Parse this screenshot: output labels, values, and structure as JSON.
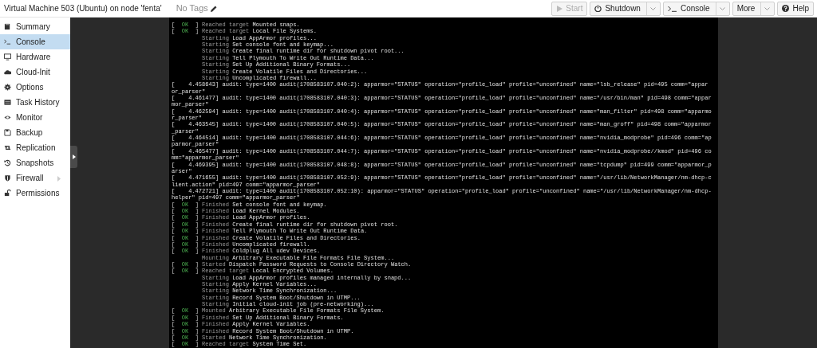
{
  "header": {
    "title": "Virtual Machine 503 (Ubuntu) on node 'fenta'",
    "tags": "No Tags",
    "buttons": [
      {
        "label": "Start",
        "kind": "start",
        "disabled": true,
        "split": false
      },
      {
        "label": "Shutdown",
        "kind": "power",
        "disabled": false,
        "split": true
      },
      {
        "label": "Console",
        "kind": "console",
        "disabled": false,
        "split": true
      },
      {
        "label": "More",
        "kind": "plain",
        "disabled": false,
        "split": true
      },
      {
        "label": "Help",
        "kind": "help",
        "disabled": false,
        "split": false
      }
    ]
  },
  "sidebar": {
    "items": [
      {
        "label": "Summary",
        "selected": false,
        "expandable": false
      },
      {
        "label": "Console",
        "selected": true,
        "expandable": false
      },
      {
        "label": "Hardware",
        "selected": false,
        "expandable": false
      },
      {
        "label": "Cloud-Init",
        "selected": false,
        "expandable": false
      },
      {
        "label": "Options",
        "selected": false,
        "expandable": false
      },
      {
        "label": "Task History",
        "selected": false,
        "expandable": false
      },
      {
        "label": "Monitor",
        "selected": false,
        "expandable": false
      },
      {
        "label": "Backup",
        "selected": false,
        "expandable": false
      },
      {
        "label": "Replication",
        "selected": false,
        "expandable": false
      },
      {
        "label": "Snapshots",
        "selected": false,
        "expandable": false
      },
      {
        "label": "Firewall",
        "selected": false,
        "expandable": true
      },
      {
        "label": "Permissions",
        "selected": false,
        "expandable": false
      }
    ]
  },
  "console": {
    "lines": [
      {
        "kind": "ok",
        "open": "[",
        "status": "OK",
        "close": "]",
        "verb": "Reached target",
        "text": "Mounted snaps."
      },
      {
        "kind": "ok",
        "open": "[",
        "status": "OK",
        "close": "]",
        "verb": "Reached target",
        "text": "Local File Systems."
      },
      {
        "kind": "plain",
        "verb": "Starting",
        "text": "Load AppArmor profiles..."
      },
      {
        "kind": "plain",
        "verb": "Starting",
        "text": "Set console font and keymap..."
      },
      {
        "kind": "plain",
        "verb": "Starting",
        "text": "Create final runtime dir for shutdown pivot root..."
      },
      {
        "kind": "plain",
        "verb": "Starting",
        "text": "Tell Plymouth To Write Out Runtime Data..."
      },
      {
        "kind": "plain",
        "verb": "Starting",
        "text": "Set Up Additional Binary Formats..."
      },
      {
        "kind": "plain",
        "verb": "Starting",
        "text": "Create Volatile Files and Directories..."
      },
      {
        "kind": "plain",
        "verb": "Starting",
        "text": "Uncomplicated firewall..."
      },
      {
        "kind": "raw",
        "text": "[    4.458643] audit: type=1400 audit(1708583107.040:2): apparmor=\"STATUS\" operation=\"profile_load\" profile=\"unconfined\" name=\"lsb_release\" pid=495 comm=\"appar"
      },
      {
        "kind": "raw",
        "text": "or_parser\""
      },
      {
        "kind": "raw",
        "text": "[    4.461477] audit: type=1400 audit(1708583107.040:3): apparmor=\"STATUS\" operation=\"profile_load\" profile=\"unconfined\" name=\"/usr/bin/man\" pid=498 comm=\"appar"
      },
      {
        "kind": "raw",
        "text": "mor_parser\""
      },
      {
        "kind": "raw",
        "text": "[    4.462594] audit: type=1400 audit(1708583107.040:4): apparmor=\"STATUS\" operation=\"profile_load\" profile=\"unconfined\" name=\"man_filter\" pid=498 comm=\"apparmo"
      },
      {
        "kind": "raw",
        "text": "r_parser\""
      },
      {
        "kind": "raw",
        "text": "[    4.463545] audit: type=1400 audit(1708583107.040:5): apparmor=\"STATUS\" operation=\"profile_load\" profile=\"unconfined\" name=\"man_groff\" pid=498 comm=\"apparmor"
      },
      {
        "kind": "raw",
        "text": "_parser\""
      },
      {
        "kind": "raw",
        "text": "[    4.464514] audit: type=1400 audit(1708583107.044:6): apparmor=\"STATUS\" operation=\"profile_load\" profile=\"unconfined\" name=\"nvidia_modprobe\" pid=496 comm=\"ap"
      },
      {
        "kind": "raw",
        "text": "parmor_parser\""
      },
      {
        "kind": "raw",
        "text": "[    4.465477] audit: type=1400 audit(1708583107.044:7): apparmor=\"STATUS\" operation=\"profile_load\" profile=\"unconfined\" name=\"nvidia_modprobe//kmod\" pid=496 co"
      },
      {
        "kind": "raw",
        "text": "mm=\"apparmor_parser\""
      },
      {
        "kind": "raw",
        "text": "[    4.469395] audit: type=1400 audit(1708583107.048:8): apparmor=\"STATUS\" operation=\"profile_load\" profile=\"unconfined\" name=\"tcpdump\" pid=499 comm=\"apparmor_p"
      },
      {
        "kind": "raw",
        "text": "arser\""
      },
      {
        "kind": "raw",
        "text": "[    4.471655] audit: type=1400 audit(1708583107.052:9): apparmor=\"STATUS\" operation=\"profile_load\" profile=\"unconfined\" name=\"/usr/lib/NetworkManager/nm-dhcp-c"
      },
      {
        "kind": "raw",
        "text": "lient.action\" pid=497 comm=\"apparmor_parser\""
      },
      {
        "kind": "raw",
        "text": "[    4.472721] audit: type=1400 audit(1708583107.052:10): apparmor=\"STATUS\" operation=\"profile_load\" profile=\"unconfined\" name=\"/usr/lib/NetworkManager/nm-dhcp-"
      },
      {
        "kind": "raw",
        "text": "helper\" pid=497 comm=\"apparmor_parser\""
      },
      {
        "kind": "ok",
        "open": "[",
        "status": "OK",
        "close": "]",
        "verb": "Finished",
        "text": "Set console font and keymap."
      },
      {
        "kind": "ok",
        "open": "[",
        "status": "OK",
        "close": "]",
        "verb": "Finished",
        "text": "Load Kernel Modules."
      },
      {
        "kind": "ok",
        "open": "[",
        "status": "OK",
        "close": "]",
        "verb": "Finished",
        "text": "Load AppArmor profiles."
      },
      {
        "kind": "ok",
        "open": "[",
        "status": "OK",
        "close": "]",
        "verb": "Finished",
        "text": "Create final runtime dir for shutdown pivot root."
      },
      {
        "kind": "ok",
        "open": "[",
        "status": "OK",
        "close": "]",
        "verb": "Finished",
        "text": "Tell Plymouth To Write Out Runtime Data."
      },
      {
        "kind": "ok",
        "open": "[",
        "status": "OK",
        "close": "]",
        "verb": "Finished",
        "text": "Create Volatile Files and Directories."
      },
      {
        "kind": "ok",
        "open": "[",
        "status": "OK",
        "close": "]",
        "verb": "Finished",
        "text": "Uncomplicated firewall."
      },
      {
        "kind": "ok",
        "open": "[",
        "status": "OK",
        "close": "]",
        "verb": "Finished",
        "text": "Coldplug All udev Devices."
      },
      {
        "kind": "plain",
        "verb": "Mounting",
        "text": "Arbitrary Executable File Formats File System..."
      },
      {
        "kind": "ok",
        "open": "[",
        "status": "OK",
        "close": "]",
        "verb": "Started",
        "text": "Dispatch Password Requests to Console Directory Watch."
      },
      {
        "kind": "ok",
        "open": "[",
        "status": "OK",
        "close": "]",
        "verb": "Reached target",
        "text": "Local Encrypted Volumes."
      },
      {
        "kind": "plain",
        "verb": "Starting",
        "text": "Load AppArmor profiles managed internally by snapd..."
      },
      {
        "kind": "plain",
        "verb": "Starting",
        "text": "Apply Kernel Variables..."
      },
      {
        "kind": "plain",
        "verb": "Starting",
        "text": "Network Time Synchronization..."
      },
      {
        "kind": "plain",
        "verb": "Starting",
        "text": "Record System Boot/Shutdown in UTMP..."
      },
      {
        "kind": "plain",
        "verb": "Starting",
        "text": "Initial cloud-init job (pre-networking)..."
      },
      {
        "kind": "ok",
        "open": "[",
        "status": "OK",
        "close": "]",
        "verb": "Mounted",
        "text": "Arbitrary Executable File Formats File System."
      },
      {
        "kind": "ok",
        "open": "[",
        "status": "OK",
        "close": "]",
        "verb": "Finished",
        "text": "Set Up Additional Binary Formats."
      },
      {
        "kind": "ok",
        "open": "[",
        "status": "OK",
        "close": "]",
        "verb": "Finished",
        "text": "Apply Kernel Variables."
      },
      {
        "kind": "ok",
        "open": "[",
        "status": "OK",
        "close": "]",
        "verb": "Finished",
        "text": "Record System Boot/Shutdown in UTMP."
      },
      {
        "kind": "ok",
        "open": "[",
        "status": "OK",
        "close": "]",
        "verb": "Started",
        "text": "Network Time Synchronization."
      },
      {
        "kind": "ok",
        "open": "[",
        "status": "OK",
        "close": "]",
        "verb": "Reached target",
        "text": "System Time Set."
      }
    ]
  }
}
